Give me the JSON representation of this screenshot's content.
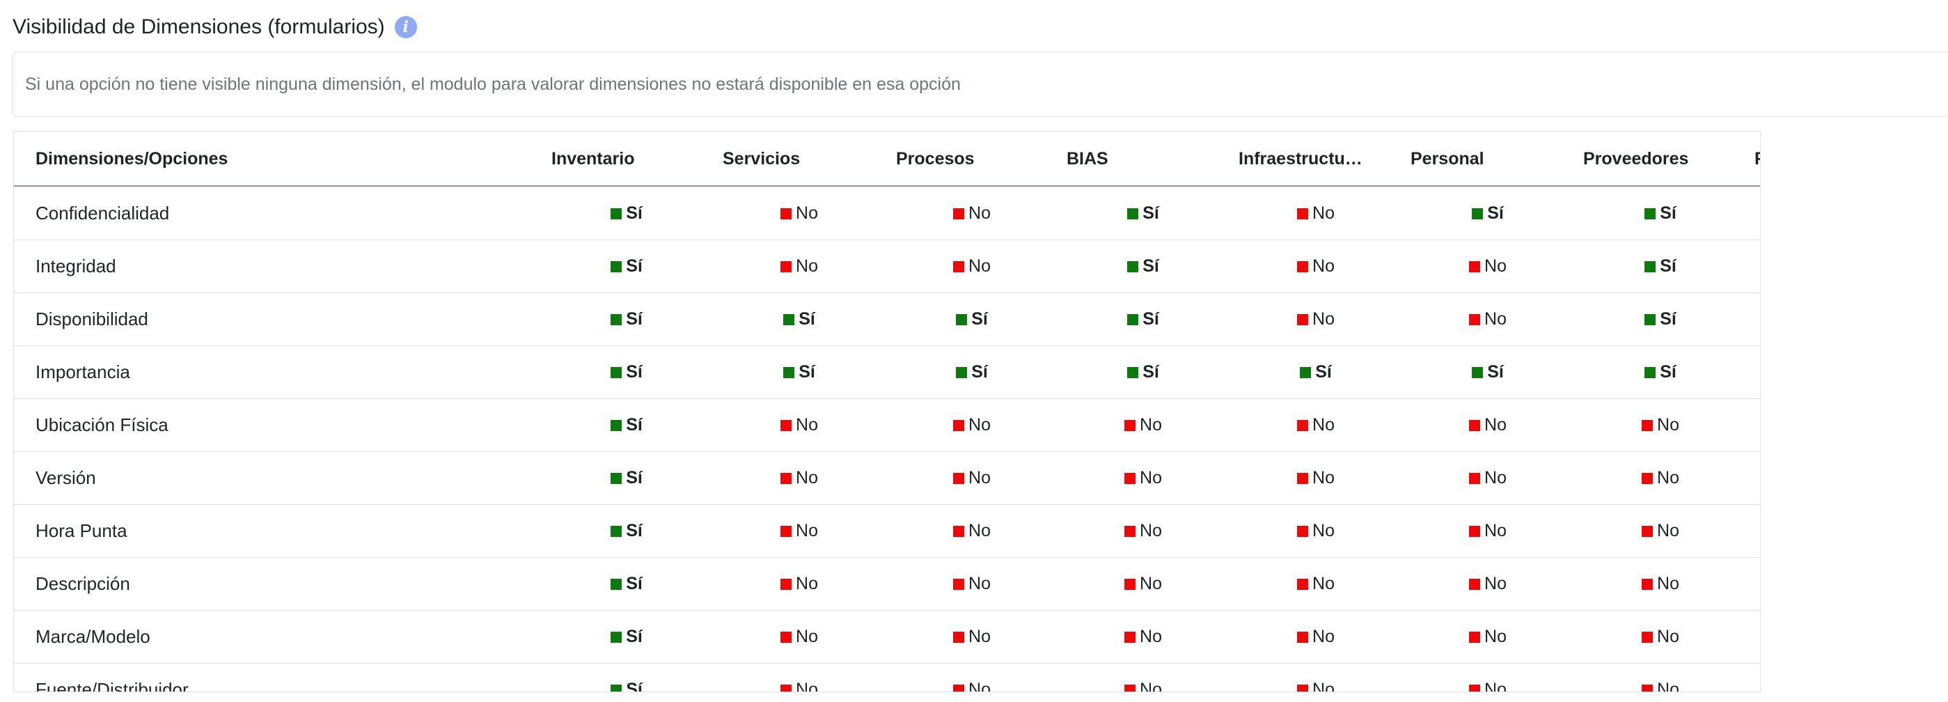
{
  "section": {
    "title": "Visibilidad de Dimensiones (formularios)",
    "info_icon": "info-icon",
    "notice": "Si una opción no tiene visible ninguna dimensión, el modulo para valorar dimensiones no estará disponible en esa opción"
  },
  "colors": {
    "yes": "#0c7a0c",
    "no": "#f20707",
    "info": "#8fa9f5"
  },
  "table": {
    "first_header": "Dimensiones/Opciones",
    "columns": [
      "Inventario",
      "Servicios",
      "Procesos",
      "BIAS",
      "Infraestructu…",
      "Personal",
      "Proveedores",
      "F"
    ],
    "yes_label": "Sí",
    "no_label": "No",
    "rows": [
      {
        "label": "Confidencialidad",
        "values": [
          true,
          false,
          false,
          true,
          false,
          true,
          true
        ]
      },
      {
        "label": "Integridad",
        "values": [
          true,
          false,
          false,
          true,
          false,
          false,
          true
        ]
      },
      {
        "label": "Disponibilidad",
        "values": [
          true,
          true,
          true,
          true,
          false,
          false,
          true
        ]
      },
      {
        "label": "Importancia",
        "values": [
          true,
          true,
          true,
          true,
          true,
          true,
          true
        ]
      },
      {
        "label": "Ubicación Física",
        "values": [
          true,
          false,
          false,
          false,
          false,
          false,
          false
        ]
      },
      {
        "label": "Versión",
        "values": [
          true,
          false,
          false,
          false,
          false,
          false,
          false
        ]
      },
      {
        "label": "Hora Punta",
        "values": [
          true,
          false,
          false,
          false,
          false,
          false,
          false
        ]
      },
      {
        "label": "Descripción",
        "values": [
          true,
          false,
          false,
          false,
          false,
          false,
          false
        ]
      },
      {
        "label": "Marca/Modelo",
        "values": [
          true,
          false,
          false,
          false,
          false,
          false,
          false
        ]
      },
      {
        "label": "Fuente/Distribuidor",
        "values": [
          true,
          false,
          false,
          false,
          false,
          false,
          false
        ]
      }
    ]
  }
}
